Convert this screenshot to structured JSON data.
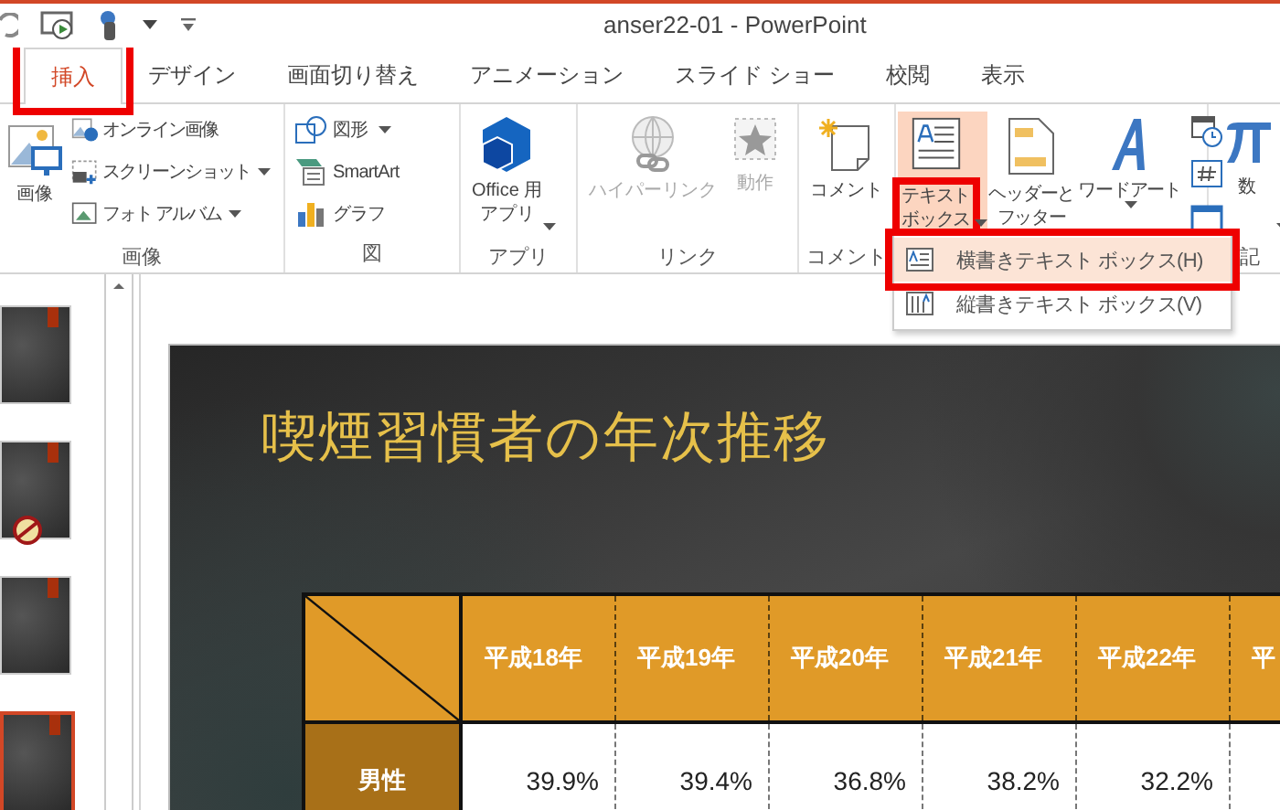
{
  "window": {
    "title": "anser22-01 - PowerPoint"
  },
  "tabs": [
    {
      "label": "挿入",
      "selected": true,
      "highlighted": true
    },
    {
      "label": "デザイン",
      "selected": false
    },
    {
      "label": "画面切り替え",
      "selected": false
    },
    {
      "label": "アニメーション",
      "selected": false
    },
    {
      "label": "スライド ショー",
      "selected": false
    },
    {
      "label": "校閲",
      "selected": false
    },
    {
      "label": "表示",
      "selected": false
    }
  ],
  "ribbon": {
    "groups": [
      {
        "label": "画像",
        "large": [
          {
            "lines": [
              "画像"
            ]
          }
        ],
        "small": [
          {
            "label": "オンライン画像",
            "dropdown": false
          },
          {
            "label": "スクリーンショット",
            "dropdown": true
          },
          {
            "label": "フォト アルバム",
            "dropdown": true
          }
        ]
      },
      {
        "label": "図",
        "small": [
          {
            "label": "図形",
            "dropdown": true
          },
          {
            "label": "SmartArt",
            "dropdown": false
          },
          {
            "label": "グラフ",
            "dropdown": false
          }
        ]
      },
      {
        "label": "アプリ",
        "large": [
          {
            "lines": [
              "Office 用",
              "アプリ"
            ],
            "dropdown": true
          }
        ]
      },
      {
        "label": "リンク",
        "large": [
          {
            "lines": [
              "ハイパーリンク"
            ],
            "disabled": true
          },
          {
            "lines": [
              "動作"
            ],
            "disabled": true
          }
        ]
      },
      {
        "label": "コメント",
        "large": [
          {
            "lines": [
              "コメント"
            ]
          }
        ]
      },
      {
        "large": [
          {
            "lines": [
              "テキスト",
              "ボックス"
            ],
            "dropdown": true,
            "pressed": true,
            "highlighted": true
          },
          {
            "lines": [
              "ヘッダーと",
              "フッター"
            ]
          },
          {
            "lines": [
              "ワードアート"
            ],
            "dropdown": true
          }
        ]
      },
      {
        "label": "記",
        "large": [
          {
            "lines": [
              "数"
            ],
            "dropdown": true
          }
        ]
      }
    ]
  },
  "menu": {
    "items": [
      {
        "label": "横書きテキスト ボックス(H)",
        "selected": true,
        "highlighted": true
      },
      {
        "label": "縦書きテキスト ボックス(V)",
        "selected": false
      }
    ]
  },
  "thumbnails": [
    {
      "selected": false
    },
    {
      "selected": false
    },
    {
      "selected": false
    },
    {
      "selected": true
    }
  ],
  "slide": {
    "title": "喫煙習慣者の年次推移",
    "table": {
      "columns": [
        "平成18年",
        "平成19年",
        "平成20年",
        "平成21年",
        "平成22年",
        "平"
      ],
      "rows": [
        {
          "label": "男性",
          "cells": [
            "39.9%",
            "39.4%",
            "36.8%",
            "38.2%",
            "32.2%"
          ]
        }
      ]
    }
  }
}
